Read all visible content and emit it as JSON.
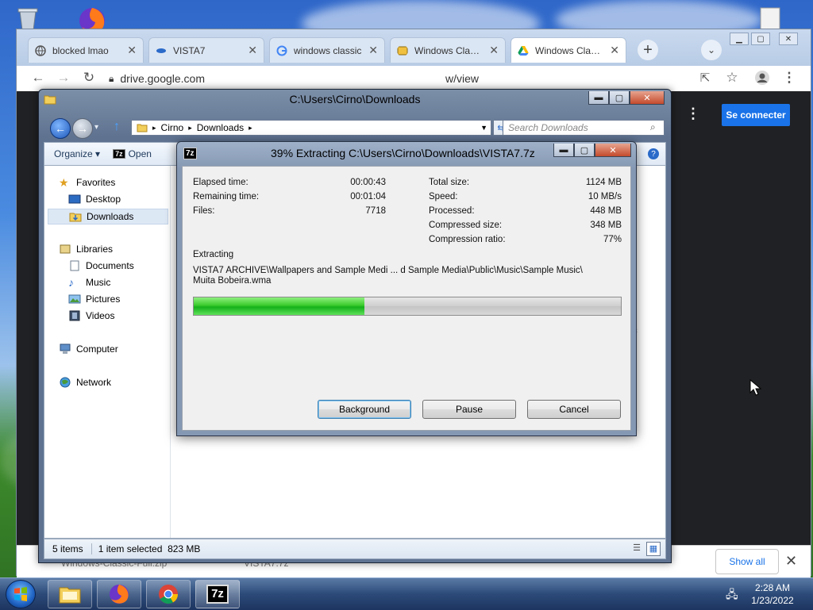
{
  "chrome": {
    "tabs": [
      {
        "title": "blocked lmao",
        "icon": "globe-icon",
        "active": false
      },
      {
        "title": "VISTA7",
        "icon": "vista7-favicon",
        "active": false
      },
      {
        "title": "windows classic",
        "icon": "google-icon",
        "active": false
      },
      {
        "title": "Windows Classic",
        "icon": "betaarchive-favicon",
        "active": false
      },
      {
        "title": "Windows Classic",
        "icon": "google-drive-icon",
        "active": true
      }
    ],
    "url_left": "drive.google.com",
    "url_right": "w/view",
    "signin_label": "Se connecter",
    "download_bar": {
      "items": [
        "Windows-Classic-Full.zip",
        "VISTA7.7z"
      ],
      "show_all_label": "Show all"
    }
  },
  "explorer": {
    "title": "C:\\Users\\Cirno\\Downloads",
    "breadcrumb": [
      "Cirno",
      "Downloads"
    ],
    "search_placeholder": "Search Downloads",
    "cmdbar": {
      "organize": "Organize",
      "open": "Open"
    },
    "navpane": {
      "favorites": "Favorites",
      "desktop": "Desktop",
      "downloads": "Downloads",
      "libraries": "Libraries",
      "documents": "Documents",
      "music": "Music",
      "pictures": "Pictures",
      "videos": "Videos",
      "computer": "Computer",
      "network": "Network"
    },
    "status": {
      "items": "5 items",
      "selected": "1 item selected",
      "size": "823 MB"
    },
    "partial_text": "ic"
  },
  "zip": {
    "title": "39% Extracting C:\\Users\\Cirno\\Downloads\\VISTA7.7z",
    "app_icon": "7z",
    "left_stats": [
      {
        "label": "Elapsed time:",
        "value": "00:00:43"
      },
      {
        "label": "Remaining time:",
        "value": "00:01:04"
      },
      {
        "label": "Files:",
        "value": "7718"
      }
    ],
    "right_stats": [
      {
        "label": "Total size:",
        "value": "1124 MB"
      },
      {
        "label": "Speed:",
        "value": "10 MB/s"
      },
      {
        "label": "Processed:",
        "value": "448 MB"
      },
      {
        "label": "Compressed size:",
        "value": "348 MB"
      },
      {
        "label": "Compression ratio:",
        "value": "77%"
      }
    ],
    "status_label": "Extracting",
    "current_file_line1": "VISTA7 ARCHIVE\\Wallpapers and Sample Medi ... d Sample Media\\Public\\Music\\Sample Music\\",
    "current_file_line2": "Muita Bobeira.wma",
    "progress": 0.4,
    "buttons": {
      "background": "Background",
      "pause": "Pause",
      "cancel": "Cancel"
    }
  },
  "taskbar": {
    "items": [
      "explorer-icon",
      "firefox-icon",
      "chrome-icon",
      "7zip-icon"
    ],
    "zip_button_label": "7z",
    "time": "2:28 AM",
    "date": "1/23/2022"
  },
  "colors": {
    "drive_blue": "#1a73e8",
    "progress_green": "#14b01a"
  }
}
